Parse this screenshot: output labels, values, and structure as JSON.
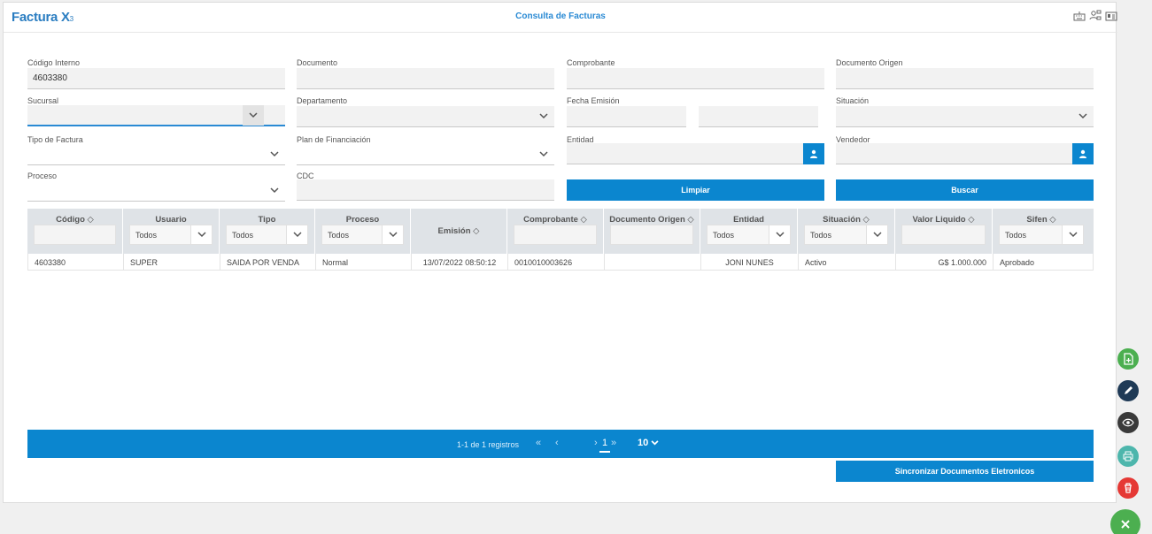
{
  "header": {
    "logo": "Factura X",
    "logo_sub": "3",
    "title": "Consulta de Facturas",
    "icons": [
      "keyboard-icon",
      "users-network-icon",
      "id-card-icon"
    ]
  },
  "filters": {
    "codigo_interno": {
      "label": "Código Interno",
      "value": "4603380"
    },
    "documento": {
      "label": "Documento",
      "value": ""
    },
    "comprobante": {
      "label": "Comprobante",
      "value": ""
    },
    "documento_origen": {
      "label": "Documento Origen",
      "value": ""
    },
    "sucursal": {
      "label": "Sucursal",
      "value": ""
    },
    "departamento": {
      "label": "Departamento",
      "value": ""
    },
    "fecha_emision": {
      "label": "Fecha Emisión",
      "from": "",
      "to": ""
    },
    "situacion": {
      "label": "Situación",
      "value": ""
    },
    "tipo_factura": {
      "label": "Tipo de Factura",
      "value": ""
    },
    "plan_financiacion": {
      "label": "Plan de Financiación",
      "value": ""
    },
    "entidad": {
      "label": "Entidad",
      "value": ""
    },
    "vendedor": {
      "label": "Vendedor",
      "value": ""
    },
    "proceso": {
      "label": "Proceso",
      "value": ""
    },
    "cdc": {
      "label": "CDC",
      "value": ""
    },
    "limpiar_label": "Limpiar",
    "buscar_label": "Buscar"
  },
  "table": {
    "columns": [
      {
        "label": "Código",
        "sortable": true,
        "filter": "text"
      },
      {
        "label": "Usuario",
        "sortable": false,
        "filter": "select",
        "value": "Todos"
      },
      {
        "label": "Tipo",
        "sortable": false,
        "filter": "select",
        "value": "Todos"
      },
      {
        "label": "Proceso",
        "sortable": false,
        "filter": "select",
        "value": "Todos"
      },
      {
        "label": "Emisión",
        "sortable": true,
        "filter": "none"
      },
      {
        "label": "Comprobante",
        "sortable": true,
        "filter": "text"
      },
      {
        "label": "Documento Origen",
        "sortable": true,
        "filter": "text"
      },
      {
        "label": "Entidad",
        "sortable": false,
        "filter": "select",
        "value": "Todos"
      },
      {
        "label": "Situación",
        "sortable": true,
        "filter": "select",
        "value": "Todos"
      },
      {
        "label": "Valor Liquido",
        "sortable": true,
        "filter": "text"
      },
      {
        "label": "Sifen",
        "sortable": true,
        "filter": "select",
        "value": "Todos"
      }
    ],
    "rows": [
      [
        "4603380",
        "SUPER",
        "SAIDA POR VENDA",
        "Normal",
        "13/07/2022 08:50:12",
        "0010010003626",
        "",
        "JONI NUNES",
        "Activo",
        "G$ 1.000.000",
        "Aprobado"
      ]
    ]
  },
  "pagination": {
    "info": "1-1 de 1 registros",
    "current_page": "1",
    "page_size": "10"
  },
  "sync_button": "Sincronizar Documentos Eletronicos",
  "actions": [
    {
      "name": "new-document-icon",
      "color": "#4caf50"
    },
    {
      "name": "edit-pencil-icon",
      "color": "#1f3a56"
    },
    {
      "name": "view-eye-icon",
      "color": "#3a3a3a"
    },
    {
      "name": "print-icon",
      "color": "#4db6ac"
    },
    {
      "name": "delete-trash-icon",
      "color": "#e53935"
    },
    {
      "name": "close-icon",
      "color": "#4caf50"
    }
  ]
}
